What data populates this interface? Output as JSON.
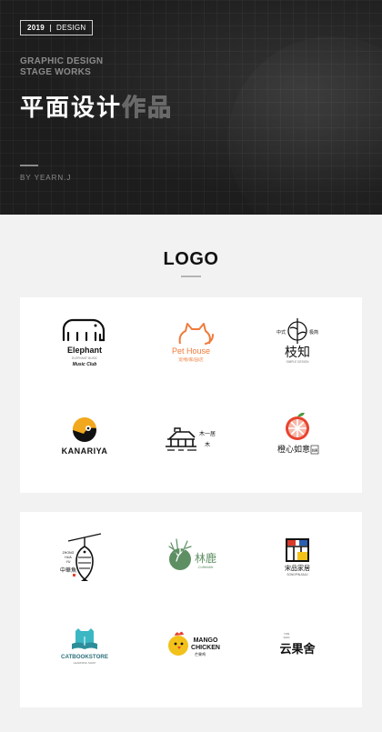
{
  "header": {
    "year": "2019",
    "category": "DESIGN",
    "title_en_line1": "GRAPHIC DESIGN",
    "title_en_line2": "STAGE WORKS",
    "title_cn_main": "平面设计",
    "title_cn_outline": "作品",
    "author": "BY YEARN.J"
  },
  "section": {
    "title": "LOGO"
  },
  "logos": {
    "elephant": {
      "name": "Elephant",
      "small": "ELEPHANT MUSIC",
      "sub": "Music Club"
    },
    "pethouse": {
      "name": "Pet House",
      "sub": "宠/物/家/园/店"
    },
    "zhizhi": {
      "name": "枝知",
      "left": "中式",
      "right": "极简",
      "sub": "SIMPLE DESIGN"
    },
    "kanariya": {
      "name": "KANARIYA"
    },
    "building": {
      "cn1": "木一居",
      "cn2": "木"
    },
    "orange": {
      "name": "橙心如意",
      "tag": "鲜果"
    },
    "fish": {
      "pinyin1": "ZHONG",
      "pinyin2": "HUA",
      "pinyin3": "YU",
      "name": "中華魚"
    },
    "deer": {
      "name": "林鹿",
      "sub": "CoffeMilk"
    },
    "home": {
      "name": "宋品家居",
      "sub": "SONGPINJIAJU"
    },
    "book": {
      "name": "CATBOOKSTORE",
      "sub": "LEARNING SHOP"
    },
    "mango": {
      "line1": "MANGO",
      "line2": "CHICKEN",
      "sub": "芒果鸡"
    },
    "fruit": {
      "small1": "YUN",
      "small2": "GUO",
      "name": "云果舍"
    }
  },
  "colors": {
    "header_bg": "#1d1d1d",
    "page_bg": "#f2f2f2",
    "pethouse": "#f07a3a",
    "orange": "#e8432f",
    "kanariya": "#f2a81d",
    "deer": "#5e8f63",
    "book": "#3ab7c3",
    "mango": "#f2c21a",
    "home_red": "#d93a2b",
    "home_blue": "#2b5fb3",
    "home_yellow": "#f2c21a"
  }
}
